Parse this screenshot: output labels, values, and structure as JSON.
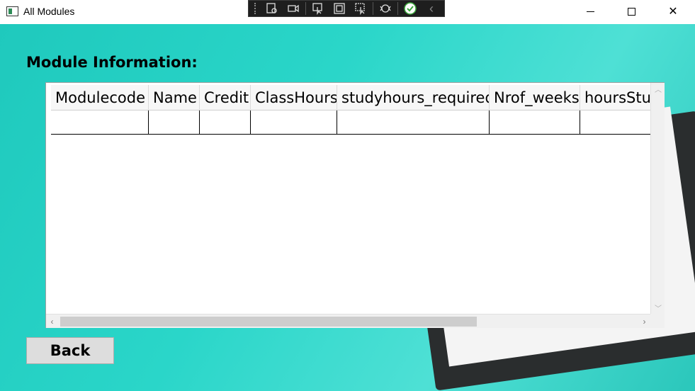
{
  "window": {
    "title": "All Modules",
    "minimize_glyph": "",
    "close_glyph": "✕"
  },
  "debug_toolbar": {
    "icons": [
      "select-element-icon",
      "video-icon",
      "pointer-select-icon",
      "display-layout-icon",
      "track-focus-icon",
      "hot-reload-icon",
      "check-icon",
      "collapse-icon"
    ],
    "collapse_glyph": "‹"
  },
  "page": {
    "heading": "Module Information:",
    "back_label": "Back"
  },
  "grid": {
    "columns": [
      "Modulecode",
      "Name",
      "Credit",
      "ClassHours",
      "studyhours_required",
      "Nrof_weeks",
      "hoursStudied"
    ],
    "rows": [
      [
        "",
        "",
        "",
        "",
        "",
        "",
        ""
      ]
    ]
  },
  "colors": {
    "background": "#2ad6c9",
    "toolbar_bg": "#1e1e1e",
    "button_bg": "#dddddd"
  }
}
